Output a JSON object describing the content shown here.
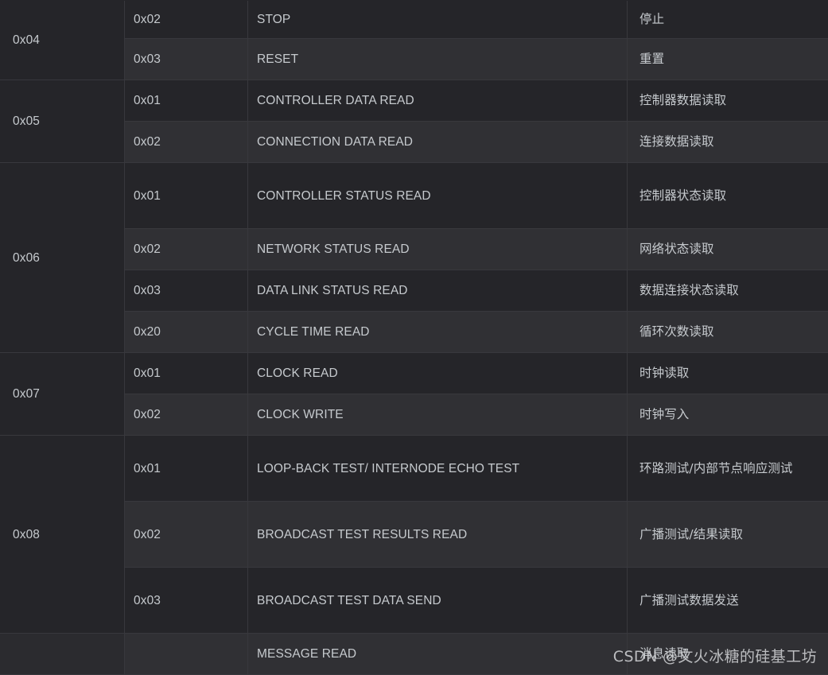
{
  "table": {
    "columns": [
      "command_group",
      "sub_command",
      "description_en",
      "description_cn"
    ],
    "rows": [
      {
        "group": "0x04",
        "group_rowspan": 2,
        "sub": "0x02",
        "en": "STOP",
        "cn": "停止"
      },
      {
        "group": "",
        "group_rowspan": 0,
        "sub": "0x03",
        "en": "RESET",
        "cn": "重置"
      },
      {
        "group": "0x05",
        "group_rowspan": 2,
        "sub": "0x01",
        "en": "CONTROLLER DATA READ",
        "cn": "控制器数据读取"
      },
      {
        "group": "",
        "group_rowspan": 0,
        "sub": "0x02",
        "en": "CONNECTION DATA READ",
        "cn": "连接数据读取"
      },
      {
        "group": "0x06",
        "group_rowspan": 4,
        "sub": "0x01",
        "en": "CONTROLLER STATUS READ",
        "cn": "控制器状态读取"
      },
      {
        "group": "",
        "group_rowspan": 0,
        "sub": "0x02",
        "en": "NETWORK STATUS READ",
        "cn": "网络状态读取"
      },
      {
        "group": "",
        "group_rowspan": 0,
        "sub": "0x03",
        "en": "DATA LINK STATUS READ",
        "cn": "数据连接状态读取"
      },
      {
        "group": "",
        "group_rowspan": 0,
        "sub": "0x20",
        "en": "CYCLE TIME READ",
        "cn": "循环次数读取"
      },
      {
        "group": "0x07",
        "group_rowspan": 2,
        "sub": "0x01",
        "en": "CLOCK READ",
        "cn": "时钟读取"
      },
      {
        "group": "",
        "group_rowspan": 0,
        "sub": "0x02",
        "en": "CLOCK WRITE",
        "cn": "时钟写入"
      },
      {
        "group": "0x08",
        "group_rowspan": 3,
        "sub": "0x01",
        "en": "LOOP-BACK TEST/ INTERNODE ECHO TEST",
        "cn": "环路测试/内部节点响应测试"
      },
      {
        "group": "",
        "group_rowspan": 0,
        "sub": "0x02",
        "en": "BROADCAST TEST RESULTS READ",
        "cn": "广播测试/结果读取"
      },
      {
        "group": "",
        "group_rowspan": 0,
        "sub": "0x03",
        "en": "BROADCAST TEST DATA SEND",
        "cn": "广播测试数据发送"
      },
      {
        "group": "",
        "group_rowspan": 1,
        "sub": "",
        "en": "MESSAGE READ",
        "cn": "消息读取"
      }
    ]
  },
  "watermark": {
    "text": "CSDN @文火冰糖的硅基工坊"
  },
  "colors": {
    "row_dark": "#252529",
    "row_light": "#303034",
    "border": "#38383d",
    "text": "#c6cace"
  }
}
